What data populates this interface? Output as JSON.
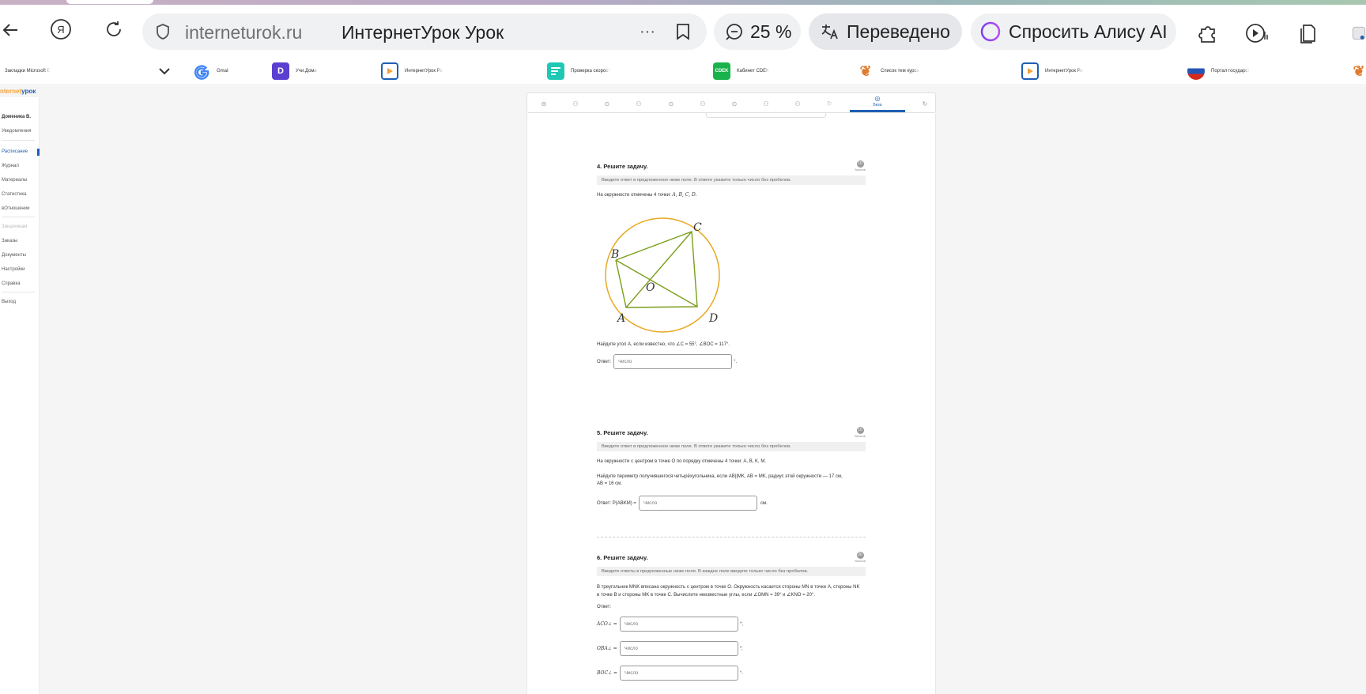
{
  "browser": {
    "domain": "interneturok.ru",
    "page_title": "ИнтернетУрок Урок",
    "zoom": "25 %",
    "translated": "Переведено",
    "ask_alice": "Спросить Алису AI",
    "bookmarks": [
      {
        "label": "Закладки Microsoft E",
        "color": "#ffffff"
      },
      {
        "label": "Gmail",
        "color": "#ffffff"
      },
      {
        "label": "Учи.Дома",
        "color": "#5b3fd1"
      },
      {
        "label": "ИнтернетУрок Ра",
        "color": "#ffffff"
      },
      {
        "label": "Проверка скорост",
        "color": "#1ec8b5"
      },
      {
        "label": "Кабинет CDEK",
        "color": "#1ab24b"
      },
      {
        "label": "Список тем курса",
        "color": "#ffffff"
      },
      {
        "label": "ИнтернетУрок Ра",
        "color": "#ffffff"
      },
      {
        "label": "Портал государст",
        "color": "#ffffff"
      }
    ]
  },
  "site": {
    "logo_a": "nternet",
    "logo_b": "урок",
    "user": "Доменика В.",
    "sidebar": {
      "notifications": "Уведомления",
      "items": [
        "Расписание",
        "Журнал",
        "Материалы",
        "Статистика",
        "вОтношении"
      ],
      "group_label": "Заказчикам",
      "items2": [
        "Заказы",
        "Документы",
        "Настройки",
        "Справка"
      ],
      "logout": "Выход"
    },
    "nav": {
      "active_label": "Беза"
    }
  },
  "questions": {
    "q4": {
      "title": "4. Решите задачу.",
      "badge": "10",
      "badge_label": "баллов",
      "hint": "Введите ответ в предложенное ниже поле. В ответе укажите только число без пробелов.",
      "text": "На окружности отмечены 4 точки:",
      "points": "A, B, C, D.",
      "labels": {
        "A": "A",
        "B": "B",
        "C": "C",
        "D": "D",
        "O": "O"
      },
      "question": "Найдите угол A, если известно, что ∠C = 55°, ∠BOC = 117°.",
      "answer_label": "Ответ:",
      "placeholder": "Число",
      "unit": "°."
    },
    "q5": {
      "title": "5. Решите задачу.",
      "badge": "15",
      "badge_label": "баллов",
      "hint": "Введите ответ в предложенное ниже поле. В ответе укажите только число без пробелов.",
      "text1": "На окружности с центром в точке O по порядку отмечены 4 точки: A, B, K, M.",
      "text2": "Найдите периметр получившегося четырёхугольника, если AB||MK, AB = MK, радиус этой окружности — 17 см, AB = 16 см.",
      "answer_label": "Ответ: P(ABKM) =",
      "placeholder": "Число",
      "unit": "см."
    },
    "q6": {
      "title": "6. Решите задачу.",
      "badge": "20",
      "badge_label": "баллов",
      "hint": "Введите ответы в предложенные ниже поля. В каждое поле введите только число без пробелов.",
      "text": "В треугольник MNK вписана окружность с центром в точке O. Окружность касается стороны MN в точке A, стороны NK в точке B и стороны MK в точке C. Вычислите неизвестные углы, если ∠OMN = 39° и ∠KNO = 20°.",
      "answer_label": "Ответ:",
      "rows": [
        {
          "label": "ACO∠ =",
          "placeholder": "Число",
          "unit": "°;"
        },
        {
          "label": "OBA∠ =",
          "placeholder": "Число",
          "unit": "°;"
        },
        {
          "label": "BOC∠ =",
          "placeholder": "Число",
          "unit": "°."
        }
      ]
    }
  }
}
